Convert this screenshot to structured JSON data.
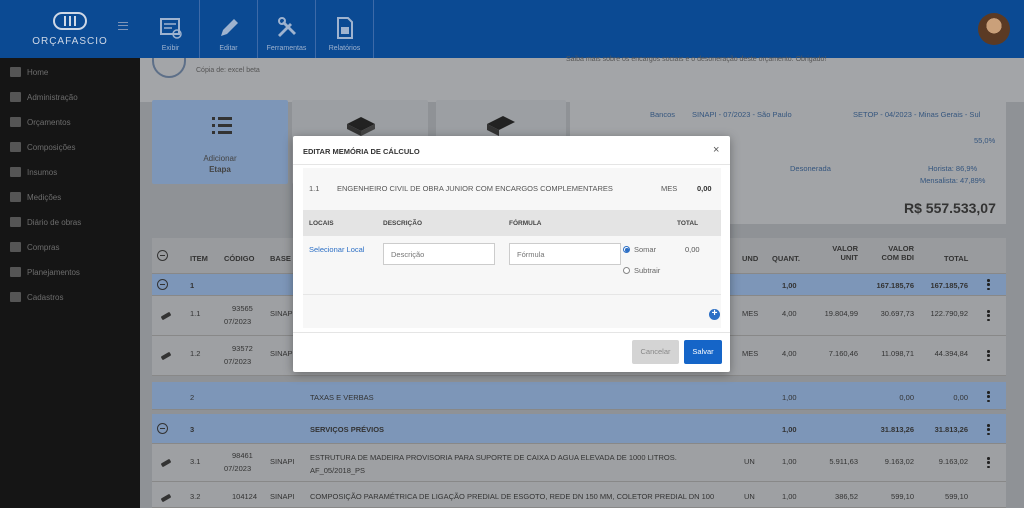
{
  "app": {
    "logo_text": "ORÇAFASCIO"
  },
  "toolbar": [
    {
      "label": "Exibir",
      "icon": "display-icon"
    },
    {
      "label": "Editar",
      "icon": "pencil-icon"
    },
    {
      "label": "Ferramentas",
      "icon": "tools-icon"
    },
    {
      "label": "Relatórios",
      "icon": "report-icon"
    }
  ],
  "sidebar": [
    {
      "label": "Home",
      "icon": "home-icon"
    },
    {
      "label": "Administração",
      "icon": "admin-icon"
    },
    {
      "label": "Orçamentos",
      "icon": "list-icon"
    },
    {
      "label": "Composições",
      "icon": "compositions-icon"
    },
    {
      "label": "Insumos",
      "icon": "inputs-icon"
    },
    {
      "label": "Medições",
      "icon": "measure-icon"
    },
    {
      "label": "Diário de obras",
      "icon": "diary-icon"
    },
    {
      "label": "Compras",
      "icon": "cart-icon"
    },
    {
      "label": "Planejamentos",
      "icon": "calendar-icon"
    },
    {
      "label": "Cadastros",
      "icon": "register-icon"
    }
  ],
  "page": {
    "subtitle": "Cópia de: excel beta",
    "notice": "Saiba mais sobre os encargos sociais e o desoneração deste orçamento. Obrigado!"
  },
  "cards": [
    {
      "label": "Adicionar",
      "sub": "Etapa"
    },
    {
      "label": "",
      "sub": ""
    },
    {
      "label": "",
      "sub": ""
    }
  ],
  "info": {
    "bancos_label": "Bancos",
    "banco1": "SINAPI - 07/2023 - São Paulo",
    "banco2": "SETOP - 04/2023 - Minas Gerais - Sul",
    "bdi": "55,0%",
    "desonerada": "Desonerada",
    "horista": "Horista: 86,9%",
    "mensalista": "Mensalista: 47,89%",
    "total": "R$ 557.533,07"
  },
  "table": {
    "headers": {
      "item": "ITEM",
      "codigo": "CÓDIGO",
      "base": "BASE",
      "und": "UND",
      "quant": "QUANT.",
      "valor_unit": "VALOR UNIT",
      "valor_bdi": "VALOR COM BDI",
      "total": "TOTAL"
    },
    "rows": [
      {
        "kind": "stage",
        "item": "1",
        "codigo": "",
        "codigo2": "",
        "base": "",
        "desc": "",
        "und": "",
        "quant": "1,00",
        "vunit": "",
        "vbdi": "167.185,76",
        "total": "167.185,76"
      },
      {
        "kind": "comp",
        "item": "1.1",
        "codigo": "93565",
        "codigo2": "07/2023",
        "base": "SINAPI",
        "desc": "",
        "und": "MES",
        "quant": "4,00",
        "vunit": "19.804,99",
        "vbdi": "30.697,73",
        "total": "122.790,92"
      },
      {
        "kind": "comp",
        "item": "1.2",
        "codigo": "93572",
        "codigo2": "07/2023",
        "base": "SINAPI",
        "desc": "",
        "und": "MES",
        "quant": "4,00",
        "vunit": "7.160,46",
        "vbdi": "11.098,71",
        "total": "44.394,84"
      },
      {
        "kind": "light",
        "item": "2",
        "codigo": "",
        "codigo2": "",
        "base": "",
        "desc": "TAXAS E VERBAS",
        "und": "",
        "quant": "1,00",
        "vunit": "",
        "vbdi": "0,00",
        "total": "0,00"
      },
      {
        "kind": "stage",
        "item": "3",
        "codigo": "",
        "codigo2": "",
        "base": "",
        "desc": "SERVIÇOS PRÉVIOS",
        "und": "",
        "quant": "1,00",
        "vunit": "",
        "vbdi": "31.813,26",
        "total": "31.813,26"
      },
      {
        "kind": "comp",
        "item": "3.1",
        "codigo": "98461",
        "codigo2": "07/2023",
        "base": "SINAPI",
        "desc": "ESTRUTURA DE MADEIRA PROVISORIA PARA SUPORTE DE CAIXA D AGUA ELEVADA DE 1000 LITROS. AF_05/2018_PS",
        "und": "UN",
        "quant": "1,00",
        "vunit": "5.911,63",
        "vbdi": "9.163,02",
        "total": "9.163,02"
      },
      {
        "kind": "comp",
        "item": "3.2",
        "codigo": "104124",
        "codigo2": "",
        "base": "SINAPI",
        "desc": "COMPOSIÇÃO PARAMÉTRICA DE LIGAÇÃO PREDIAL DE ESGOTO, REDE DN 150 MM, COLETOR PREDIAL DN 100",
        "und": "UN",
        "quant": "1,00",
        "vunit": "386,52",
        "vbdi": "599,10",
        "total": "599,10"
      }
    ]
  },
  "modal": {
    "title": "EDITAR MEMÓRIA DE CÁLCULO",
    "close": "×",
    "item_num": "1.1",
    "item_desc": "ENGENHEIRO CIVIL DE OBRA JUNIOR COM ENCARGOS COMPLEMENTARES",
    "item_unit": "MES",
    "item_value": "0,00",
    "col_locais": "LOCAIS",
    "col_descricao": "DESCRIÇÃO",
    "col_formula": "FÓRMULA",
    "col_total": "TOTAL",
    "select_local": "Selecionar Local",
    "descricao_placeholder": "Descrição",
    "formula_placeholder": "Fórmula",
    "radio_somar": "Somar",
    "radio_subtrair": "Subtrair",
    "line_total": "0,00",
    "add_symbol": "+",
    "cancel_label": "Cancelar",
    "save_label": "Salvar"
  }
}
